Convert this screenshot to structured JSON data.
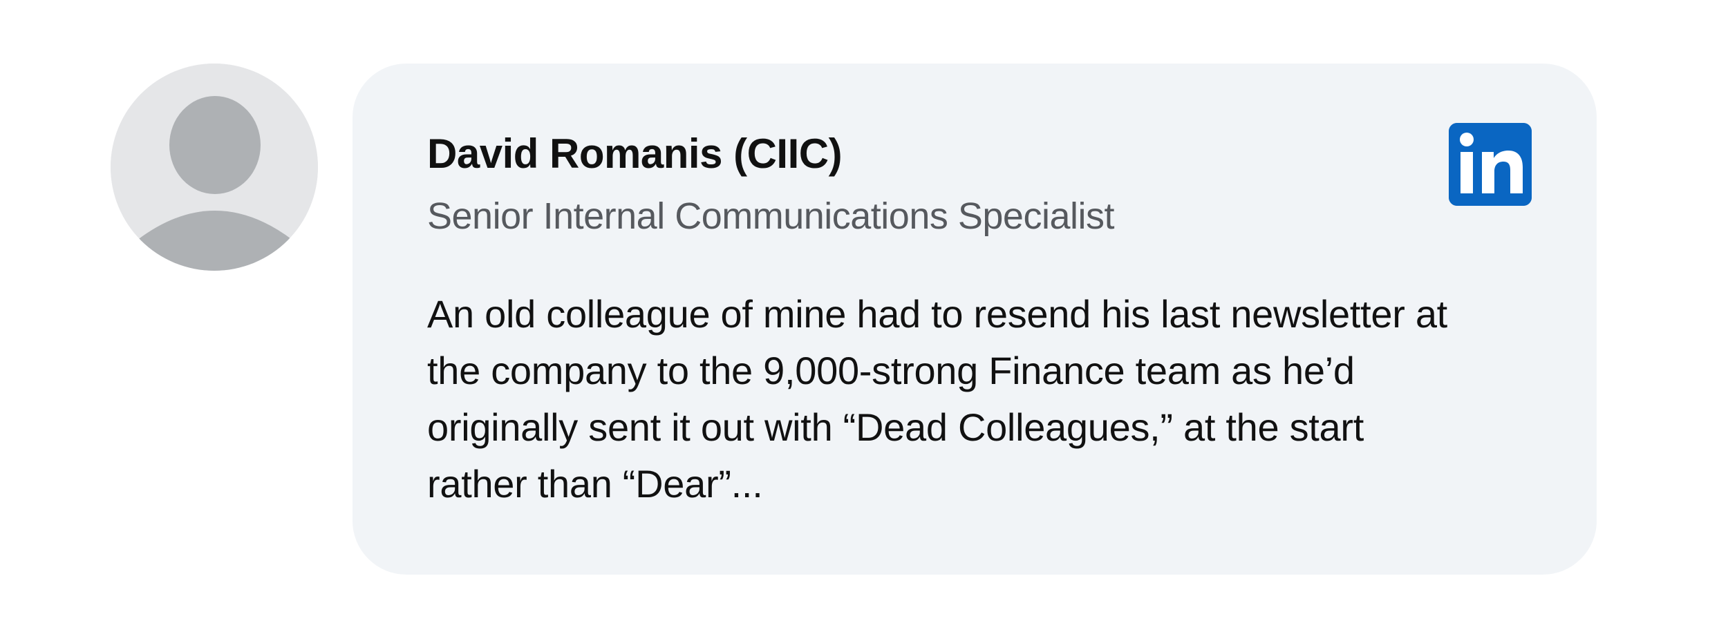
{
  "author": {
    "name": "David Romanis (CIIC)",
    "title": "Senior Internal Communications Specialist"
  },
  "post": {
    "lines": [
      "An old colleague of mine had to resend his last newsletter at",
      "the company to the 9,000-strong Finance team as he’d",
      "originally sent it out with “Dead Colleagues,” at the start",
      "rather than “Dear”..."
    ]
  },
  "icons": {
    "avatar": "default-user-avatar-icon",
    "brand": "linkedin-logo-icon"
  },
  "colors": {
    "brand": "#0a66c2",
    "card_background": "#f1f4f7",
    "avatar_background": "#e5e6e8",
    "avatar_silhouette": "#aeb1b4"
  }
}
